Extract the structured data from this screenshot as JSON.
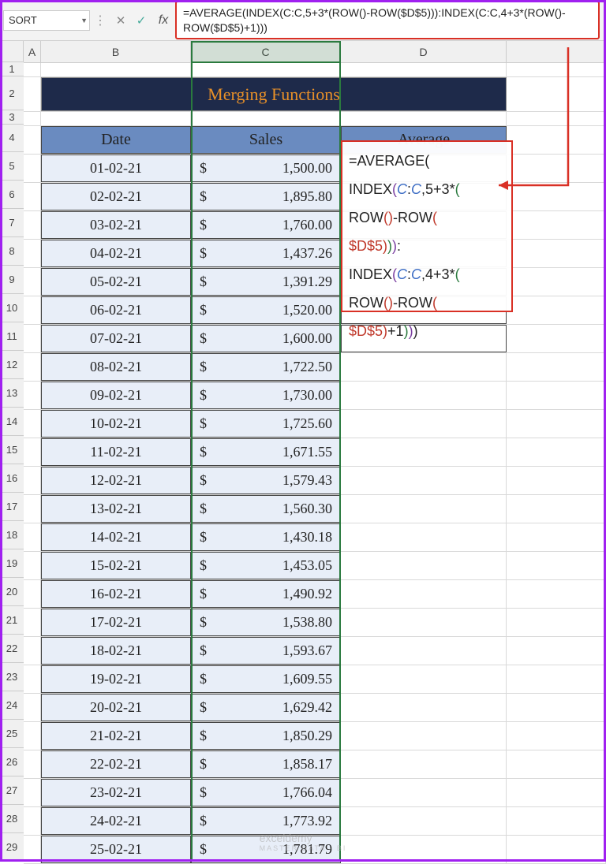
{
  "name_box": "SORT",
  "formula_bar": "=AVERAGE(INDEX(C:C,5+3*(ROW()-ROW($D$5))):INDEX(C:C,4+3*(ROW()-ROW($D$5)+1)))",
  "columns": [
    "A",
    "B",
    "C",
    "D"
  ],
  "row_numbers_pre": [
    "1",
    "2",
    "3",
    "4"
  ],
  "banner_title": "Merging Functions",
  "table_headers": {
    "date": "Date",
    "sales": "Sales",
    "average": "Average"
  },
  "rows": [
    {
      "n": "5",
      "date": "01-02-21",
      "sales": "1,500.00"
    },
    {
      "n": "6",
      "date": "02-02-21",
      "sales": "1,895.80"
    },
    {
      "n": "7",
      "date": "03-02-21",
      "sales": "1,760.00"
    },
    {
      "n": "8",
      "date": "04-02-21",
      "sales": "1,437.26"
    },
    {
      "n": "9",
      "date": "05-02-21",
      "sales": "1,391.29"
    },
    {
      "n": "10",
      "date": "06-02-21",
      "sales": "1,520.00"
    },
    {
      "n": "11",
      "date": "07-02-21",
      "sales": "1,600.00"
    },
    {
      "n": "12",
      "date": "08-02-21",
      "sales": "1,722.50"
    },
    {
      "n": "13",
      "date": "09-02-21",
      "sales": "1,730.00"
    },
    {
      "n": "14",
      "date": "10-02-21",
      "sales": "1,725.60"
    },
    {
      "n": "15",
      "date": "11-02-21",
      "sales": "1,671.55"
    },
    {
      "n": "16",
      "date": "12-02-21",
      "sales": "1,579.43"
    },
    {
      "n": "17",
      "date": "13-02-21",
      "sales": "1,560.30"
    },
    {
      "n": "18",
      "date": "14-02-21",
      "sales": "1,430.18"
    },
    {
      "n": "19",
      "date": "15-02-21",
      "sales": "1,453.05"
    },
    {
      "n": "20",
      "date": "16-02-21",
      "sales": "1,490.92"
    },
    {
      "n": "21",
      "date": "17-02-21",
      "sales": "1,538.80"
    },
    {
      "n": "22",
      "date": "18-02-21",
      "sales": "1,593.67"
    },
    {
      "n": "23",
      "date": "19-02-21",
      "sales": "1,609.55"
    },
    {
      "n": "24",
      "date": "20-02-21",
      "sales": "1,629.42"
    },
    {
      "n": "25",
      "date": "21-02-21",
      "sales": "1,850.29"
    },
    {
      "n": "26",
      "date": "22-02-21",
      "sales": "1,858.17"
    },
    {
      "n": "27",
      "date": "23-02-21",
      "sales": "1,766.04"
    },
    {
      "n": "28",
      "date": "24-02-21",
      "sales": "1,773.92"
    },
    {
      "n": "29",
      "date": "25-02-21",
      "sales": "1,781.79"
    }
  ],
  "currency": "$",
  "cell_formula_lines": [
    "=AVERAGE(",
    "INDEX(C:C,5+3*(",
    "ROW()-ROW(",
    "$D$5))):",
    "INDEX(C:C,4+3*(",
    "ROW()-ROW(",
    "$D$5)+1)))"
  ],
  "watermark": {
    "main": "exceldemy",
    "sub": "MASTER DATA · BI"
  }
}
